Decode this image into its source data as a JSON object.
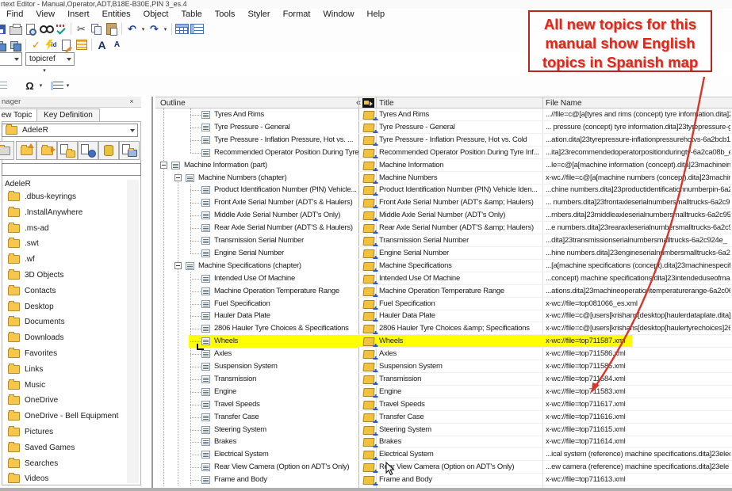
{
  "window": {
    "title": "rtext Editor - Manual,Operator,ADT,B18E-B30E,PIN 3_es.4"
  },
  "menu": {
    "items": [
      "Find",
      "View",
      "Insert",
      "Entities",
      "Object",
      "Table",
      "Tools",
      "Styler",
      "Format",
      "Window",
      "Help"
    ]
  },
  "toolbar": {
    "element_dropdown": "topicref"
  },
  "icons": {
    "undo": "↶",
    "redo": "↷",
    "dropdown": "▾",
    "scissors": "✂",
    "check": "✓",
    "omega": "Ω",
    "font_larger": "A",
    "font_smaller": "A",
    "collapse": "«",
    "close": "×",
    "id_label": "id"
  },
  "manager": {
    "title": "nager",
    "tabs": [
      {
        "label": "ew Topic"
      },
      {
        "label": "Key Definition"
      }
    ],
    "folder_dropdown": "AdeleR",
    "filter_value": "",
    "tree_root": "AdeleR",
    "folders": [
      ".dbus-keyrings",
      ".InstallAnywhere",
      ".ms-ad",
      ".swt",
      ".wf",
      "3D Objects",
      "Contacts",
      "Desktop",
      "Documents",
      "Downloads",
      "Favorites",
      "Links",
      "Music",
      "OneDrive",
      "OneDrive - Bell Equipment",
      "Pictures",
      "Saved Games",
      "Searches",
      "Videos"
    ]
  },
  "outline": {
    "header_label": "Outline",
    "columns": {
      "title": "Title",
      "file_name": "File Name"
    },
    "rows": [
      {
        "tree": "Tyres And Rims",
        "level": 3,
        "expand": false,
        "title": "Tyres And Rims",
        "file": "...//file=c@[a[tyres and rims (concept) tyre information.dita]23"
      },
      {
        "tree": "Tyre Pressure - General",
        "level": 3,
        "expand": false,
        "title": "Tyre Pressure - General",
        "file": "... pressure (concept) tyre information.dita]23tyrepressure-ge"
      },
      {
        "tree": "Tyre Pressure - Inflation Pressure, Hot vs. ...",
        "level": 3,
        "expand": false,
        "title": "Tyre Pressure - Inflation Pressure, Hot vs. Cold",
        "file": "...ation.dita]23tyrepressure-inflationpressurehotvs-6a2bcb1"
      },
      {
        "tree": "Recommended Operator Position During Tyre In...",
        "level": 3,
        "expand": false,
        "title": "Recommended Operator Position During Tyre Inf...",
        "file": "...ita]23recommendedoperatorpositionduringty-6a2ca08b_e"
      },
      {
        "tree": "Machine Information (part)",
        "level": 1,
        "expand": true,
        "title": "Machine Information",
        "file": "...le=c@[a[machine information (concept).dita]23machineinf"
      },
      {
        "tree": "Machine Numbers (chapter)",
        "level": 2,
        "expand": true,
        "title": "Machine Numbers",
        "file": "x-wc.//file=c@[a[machine numbers (concept).dita]23machine"
      },
      {
        "tree": "Product Identification Number (PIN) Vehicle...",
        "level": 3,
        "expand": false,
        "title": "Product Identification Number (PIN) Vehicle Iden...",
        "file": "...chine numbers.dita]23productidentificationnumberpin-6a2"
      },
      {
        "tree": "Front Axle Serial Number (ADT's & Haulers)",
        "level": 3,
        "expand": false,
        "title": "Front Axle Serial Number (ADT's &amp; Haulers)",
        "file": "... numbers.dita]23frontaxleserialnumbersmalltrucks-6a2c9"
      },
      {
        "tree": "Middle Axle Serial Number (ADT's Only)",
        "level": 3,
        "expand": false,
        "title": "Middle Axle Serial Number (ADT's Only)",
        "file": "...mbers.dita]23middleaxleserialnumbersmalltrucks-6a2c95"
      },
      {
        "tree": "Rear Axle Serial Number (ADT'S & Haulers)",
        "level": 3,
        "expand": false,
        "title": "Rear Axle Serial Number (ADT'S &amp; Haulers)",
        "file": "...e numbers.dita]23rearaxleserialnumbersmalltrucks-6a2c9"
      },
      {
        "tree": "Transmission Serial Number",
        "level": 3,
        "expand": false,
        "title": "Transmission Serial Number",
        "file": "...dita]23transmissionserialnumbersmalltrucks-6a2c924e_"
      },
      {
        "tree": "Engine Serial Number",
        "level": 3,
        "expand": false,
        "title": "Engine Serial Number",
        "file": "...hine numbers.dita]23engineserialnumbersmalltrucks-6a2"
      },
      {
        "tree": "Machine Specifications (chapter)",
        "level": 2,
        "expand": true,
        "title": "Machine Specifications",
        "file": "...[a[machine specifications (concept).dita]23machinespecif"
      },
      {
        "tree": "Intended Use Of Machine",
        "level": 3,
        "expand": false,
        "title": "Intended Use Of Machine",
        "file": "...concept) machine specifications.dita]23intendeduseofma"
      },
      {
        "tree": "Machine Operation Temperature Range",
        "level": 3,
        "expand": false,
        "title": "Machine Operation Temperature Range",
        "file": "...ations.dita]23machineoperationtemperaturerange-6a2c06"
      },
      {
        "tree": "Fuel Specification",
        "level": 3,
        "expand": false,
        "title": "Fuel Specification",
        "file": "x-wc://file=top081066_es.xml"
      },
      {
        "tree": "Hauler Data Plate",
        "level": 3,
        "expand": false,
        "title": "Hauler Data Plate",
        "file": "x-wc://file=c@[users[krishans[desktop[haulerdataplate.dita]2"
      },
      {
        "tree": "2806 Hauler Tyre Choices & Specifications",
        "level": 3,
        "expand": false,
        "title": "2806 Hauler Tyre Choices &amp; Specifications",
        "file": "x-wc://file=c@[users[krishans[desktop[haulertyrechoices]26"
      },
      {
        "tree": "Wheels",
        "level": 3,
        "expand": false,
        "title": "Wheels",
        "file": "x-wc://file=top711587.xml",
        "highlight": true
      },
      {
        "tree": "Axles",
        "level": 3,
        "expand": false,
        "title": "Axles",
        "file": "x-wc://file=top711586.xml"
      },
      {
        "tree": "Suspension System",
        "level": 3,
        "expand": false,
        "title": "Suspension System",
        "file": "x-wc://file=top711585.xml"
      },
      {
        "tree": "Transmission",
        "level": 3,
        "expand": false,
        "title": "Transmission",
        "file": "x-wc://file=top711584.xml"
      },
      {
        "tree": "Engine",
        "level": 3,
        "expand": false,
        "title": "Engine",
        "file": "x-wc://file=top711583.xml"
      },
      {
        "tree": "Travel Speeds",
        "level": 3,
        "expand": false,
        "title": "Travel Speeds",
        "file": "x-wc://file=top711617.xml"
      },
      {
        "tree": "Transfer Case",
        "level": 3,
        "expand": false,
        "title": "Transfer Case",
        "file": "x-wc://file=top711616.xml"
      },
      {
        "tree": "Steering System",
        "level": 3,
        "expand": false,
        "title": "Steering System",
        "file": "x-wc://file=top711615.xml"
      },
      {
        "tree": "Brakes",
        "level": 3,
        "expand": false,
        "title": "Brakes",
        "file": "x-wc://file=top711614.xml"
      },
      {
        "tree": "Electrical System",
        "level": 3,
        "expand": false,
        "title": "Electrical System",
        "file": "...ical system (reference) machine specifications.dita]23elec"
      },
      {
        "tree": "Rear View Camera (Option on ADT's Only)",
        "level": 3,
        "expand": false,
        "title": "Rear View Camera (Option on ADT's Only)",
        "file": "...ew camera (reference) machine specifications.dita]23ele"
      },
      {
        "tree": "Frame and Body",
        "level": 3,
        "expand": false,
        "title": "Frame and Body",
        "file": "x-wc://file=top711613.xml"
      }
    ]
  },
  "annotation": {
    "text": "All new topics for this manual show English topics in Spanish map",
    "color": "#e0271a"
  }
}
